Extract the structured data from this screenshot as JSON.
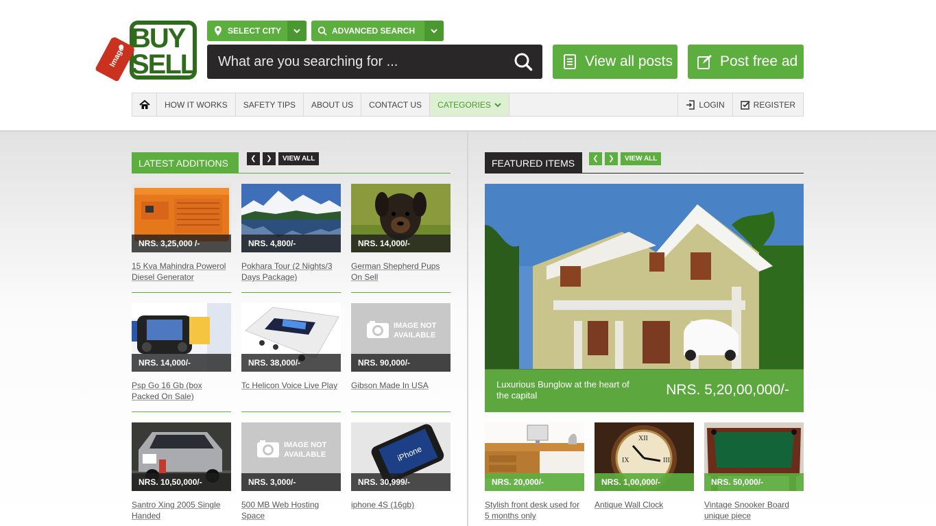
{
  "brand": {
    "logo_text_top": "BUY",
    "logo_text_bottom": "SELL",
    "logo_tag": "Image"
  },
  "header": {
    "city_label": "SELECT CITY",
    "advanced_label": "ADVANCED SEARCH",
    "search_placeholder": "What are you searching for ...",
    "view_all_posts": "View all posts",
    "post_free_ad": "Post free ad"
  },
  "nav": {
    "items": [
      "HOW IT WORKS",
      "SAFETY TIPS",
      "ABOUT US",
      "CONTACT US"
    ],
    "categories": "CATEGORIES",
    "login": "LOGIN",
    "register": "REGISTER"
  },
  "latest": {
    "title": "LATEST ADDITIONS",
    "view_all": "VIEW ALL",
    "items": [
      {
        "price": "NRS. 3,25,000 /-",
        "title": "15 Kva Mahindra Powerol Diesel Generator"
      },
      {
        "price": "NRS. 4,800/-",
        "title": "Pokhara Tour (2 Nights/3 Days Package)"
      },
      {
        "price": "NRS. 14,000/-",
        "title": "German Shepherd Pups On Sell"
      },
      {
        "price": "NRS. 14,000/-",
        "title": "Psp Go 16 Gb (box Packed On Sale)"
      },
      {
        "price": "NRS. 38,000/-",
        "title": "Tc Helicon Voice Live Play"
      },
      {
        "price": "NRS. 90,000/-",
        "title": "Gibson Made In USA"
      },
      {
        "price": "NRS. 10,50,000/-",
        "title": "Santro Xing 2005 Single Handed"
      },
      {
        "price": "NRS. 3,000/-",
        "title": "500 MB Web Hosting Space"
      },
      {
        "price": "NRS. 30,999/-",
        "title": "iphone 4S (16gb)"
      }
    ],
    "no_image_line1": "IMAGE NOT",
    "no_image_line2": "AVAILABLE"
  },
  "featured": {
    "title": "FEATURED ITEMS",
    "view_all": "VIEW ALL",
    "main": {
      "title": "Luxurious Bunglow at the heart of the capital",
      "price": "NRS. 5,20,00,000/-"
    },
    "items": [
      {
        "price": "NRS. 20,000/-",
        "title": "Stylish front desk used for 5 months only"
      },
      {
        "price": "NRS. 1,00,000/-",
        "title": "Antique Wall Clock"
      },
      {
        "price": "NRS. 50,000/-",
        "title": "Vintage Snooker Board unique piece"
      }
    ]
  },
  "colors": {
    "green": "#5cae3f",
    "dark": "#2a2728",
    "logo_green": "#2e6b1c"
  }
}
